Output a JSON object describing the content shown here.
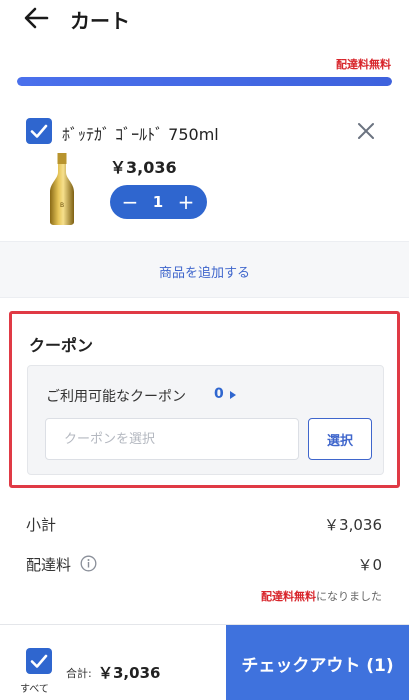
{
  "header": {
    "title": "カート"
  },
  "shipping": {
    "free_note": "配達料無料",
    "progress": 1.0
  },
  "item": {
    "name": "ﾎﾞｯﾃｶﾞ ｺﾞｰﾙﾄﾞ 750ml",
    "price": "￥3,036",
    "quantity": "1",
    "checked": true,
    "minus": "−",
    "plus": "+"
  },
  "add_items": {
    "label": "商品を追加する"
  },
  "coupon": {
    "title": "クーポン",
    "available_label": "ご利用可能なクーポン",
    "available_count": "0",
    "input_placeholder": "クーポンを選択",
    "select_label": "選択"
  },
  "summary": {
    "subtotal_label": "小計",
    "subtotal_value": "￥3,036",
    "shipping_label": "配達料",
    "shipping_value": "￥0",
    "note_highlight": "配達料無料",
    "note_rest": "になりました"
  },
  "footer": {
    "select_all_label": "すべて",
    "total_label": "合計:",
    "total_value": "￥3,036",
    "checkout_label": "チェックアウト (1)"
  },
  "colors": {
    "accent": "#2f66cf",
    "alert": "#d8262c",
    "coupon_highlight": "#e03a45"
  }
}
